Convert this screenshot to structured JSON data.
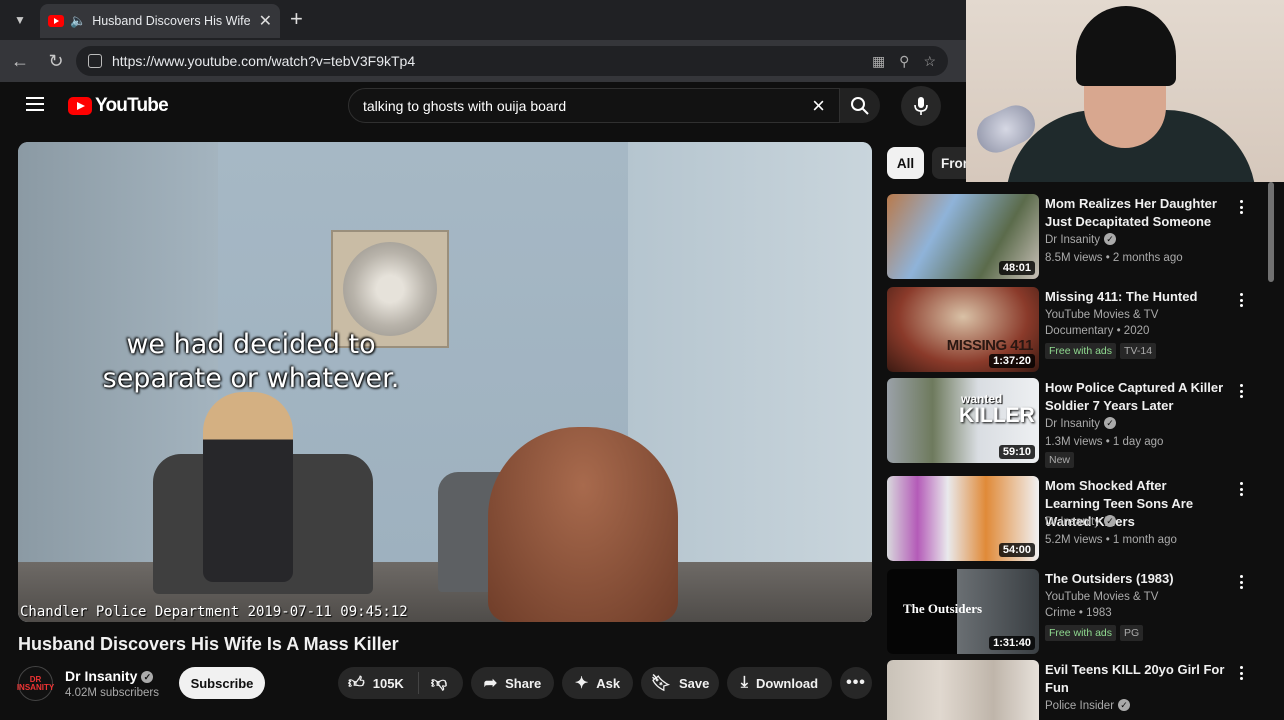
{
  "browser": {
    "tab_title": "Husband Discovers His Wife Is",
    "url": "https://www.youtube.com/watch?v=tebV3F9kTp4"
  },
  "youtube": {
    "logo_text": "YouTube",
    "search_query": "talking to ghosts with ouija board"
  },
  "video": {
    "subtitle_line1": "we had decided to",
    "subtitle_line2": "separate or whatever.",
    "timestamp": "Chandler Police Department 2019-07-11 09:45:12",
    "title": "Husband Discovers His Wife Is A Mass Killer",
    "channel": {
      "avatar_text": "DR INSANITY",
      "name": "Dr Insanity",
      "subscribers": "4.02M subscribers"
    },
    "subscribe_label": "Subscribe",
    "likes": "105K",
    "share_label": "Share",
    "ask_label": "Ask",
    "save_label": "Save",
    "download_label": "Download"
  },
  "sidebar": {
    "chips": [
      "All",
      "From"
    ],
    "recommendations": [
      {
        "title": "Mom Realizes Her Daughter Just Decapitated Someone",
        "channel": "Dr Insanity",
        "verified": true,
        "meta": "8.5M views • 2 months ago",
        "duration": "48:01"
      },
      {
        "title": "Missing 411: The Hunted",
        "channel": "YouTube Movies & TV",
        "verified": false,
        "meta": "Documentary • 2020",
        "badges": [
          "Free with ads",
          "TV-14"
        ],
        "duration": "1:37:20"
      },
      {
        "title": "How Police Captured A Killer Soldier 7 Years Later",
        "channel": "Dr Insanity",
        "verified": true,
        "meta": "1.3M views • 1 day ago",
        "badges": [
          "New"
        ],
        "duration": "59:10"
      },
      {
        "title": "Mom Shocked After Learning Teen Sons Are Wanted Killers",
        "channel": "Dr Insanity",
        "verified": true,
        "meta": "5.2M views • 1 month ago",
        "duration": "54:00"
      },
      {
        "title": "The Outsiders (1983)",
        "channel": "YouTube Movies & TV",
        "verified": false,
        "meta": "Crime • 1983",
        "badges": [
          "Free with ads",
          "PG"
        ],
        "duration": "1:31:40"
      },
      {
        "title": "Evil Teens KILL 20yo Girl For Fun",
        "channel": "Police Insider",
        "verified": true
      }
    ]
  },
  "thumbnail_text": {
    "missing411": "MISSING 411",
    "wanted": "wanted",
    "killer": "KILLER",
    "outsiders": "The Outsiders"
  },
  "colors": {
    "youtube_red": "#ff0000",
    "background": "#0f0f0f",
    "pill_bg": "#272727"
  }
}
